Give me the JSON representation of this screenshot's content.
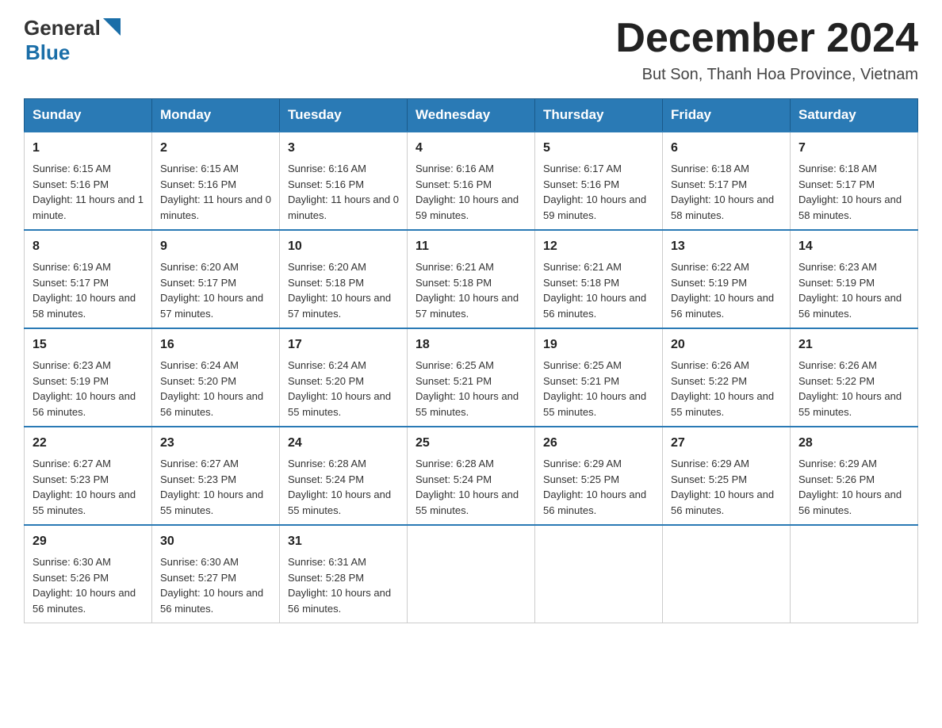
{
  "logo": {
    "general": "General",
    "blue": "Blue"
  },
  "header": {
    "title": "December 2024",
    "subtitle": "But Son, Thanh Hoa Province, Vietnam"
  },
  "weekdays": [
    "Sunday",
    "Monday",
    "Tuesday",
    "Wednesday",
    "Thursday",
    "Friday",
    "Saturday"
  ],
  "weeks": [
    [
      {
        "day": "1",
        "sunrise": "6:15 AM",
        "sunset": "5:16 PM",
        "daylight": "11 hours and 1 minute."
      },
      {
        "day": "2",
        "sunrise": "6:15 AM",
        "sunset": "5:16 PM",
        "daylight": "11 hours and 0 minutes."
      },
      {
        "day": "3",
        "sunrise": "6:16 AM",
        "sunset": "5:16 PM",
        "daylight": "11 hours and 0 minutes."
      },
      {
        "day": "4",
        "sunrise": "6:16 AM",
        "sunset": "5:16 PM",
        "daylight": "10 hours and 59 minutes."
      },
      {
        "day": "5",
        "sunrise": "6:17 AM",
        "sunset": "5:16 PM",
        "daylight": "10 hours and 59 minutes."
      },
      {
        "day": "6",
        "sunrise": "6:18 AM",
        "sunset": "5:17 PM",
        "daylight": "10 hours and 58 minutes."
      },
      {
        "day": "7",
        "sunrise": "6:18 AM",
        "sunset": "5:17 PM",
        "daylight": "10 hours and 58 minutes."
      }
    ],
    [
      {
        "day": "8",
        "sunrise": "6:19 AM",
        "sunset": "5:17 PM",
        "daylight": "10 hours and 58 minutes."
      },
      {
        "day": "9",
        "sunrise": "6:20 AM",
        "sunset": "5:17 PM",
        "daylight": "10 hours and 57 minutes."
      },
      {
        "day": "10",
        "sunrise": "6:20 AM",
        "sunset": "5:18 PM",
        "daylight": "10 hours and 57 minutes."
      },
      {
        "day": "11",
        "sunrise": "6:21 AM",
        "sunset": "5:18 PM",
        "daylight": "10 hours and 57 minutes."
      },
      {
        "day": "12",
        "sunrise": "6:21 AM",
        "sunset": "5:18 PM",
        "daylight": "10 hours and 56 minutes."
      },
      {
        "day": "13",
        "sunrise": "6:22 AM",
        "sunset": "5:19 PM",
        "daylight": "10 hours and 56 minutes."
      },
      {
        "day": "14",
        "sunrise": "6:23 AM",
        "sunset": "5:19 PM",
        "daylight": "10 hours and 56 minutes."
      }
    ],
    [
      {
        "day": "15",
        "sunrise": "6:23 AM",
        "sunset": "5:19 PM",
        "daylight": "10 hours and 56 minutes."
      },
      {
        "day": "16",
        "sunrise": "6:24 AM",
        "sunset": "5:20 PM",
        "daylight": "10 hours and 56 minutes."
      },
      {
        "day": "17",
        "sunrise": "6:24 AM",
        "sunset": "5:20 PM",
        "daylight": "10 hours and 55 minutes."
      },
      {
        "day": "18",
        "sunrise": "6:25 AM",
        "sunset": "5:21 PM",
        "daylight": "10 hours and 55 minutes."
      },
      {
        "day": "19",
        "sunrise": "6:25 AM",
        "sunset": "5:21 PM",
        "daylight": "10 hours and 55 minutes."
      },
      {
        "day": "20",
        "sunrise": "6:26 AM",
        "sunset": "5:22 PM",
        "daylight": "10 hours and 55 minutes."
      },
      {
        "day": "21",
        "sunrise": "6:26 AM",
        "sunset": "5:22 PM",
        "daylight": "10 hours and 55 minutes."
      }
    ],
    [
      {
        "day": "22",
        "sunrise": "6:27 AM",
        "sunset": "5:23 PM",
        "daylight": "10 hours and 55 minutes."
      },
      {
        "day": "23",
        "sunrise": "6:27 AM",
        "sunset": "5:23 PM",
        "daylight": "10 hours and 55 minutes."
      },
      {
        "day": "24",
        "sunrise": "6:28 AM",
        "sunset": "5:24 PM",
        "daylight": "10 hours and 55 minutes."
      },
      {
        "day": "25",
        "sunrise": "6:28 AM",
        "sunset": "5:24 PM",
        "daylight": "10 hours and 55 minutes."
      },
      {
        "day": "26",
        "sunrise": "6:29 AM",
        "sunset": "5:25 PM",
        "daylight": "10 hours and 56 minutes."
      },
      {
        "day": "27",
        "sunrise": "6:29 AM",
        "sunset": "5:25 PM",
        "daylight": "10 hours and 56 minutes."
      },
      {
        "day": "28",
        "sunrise": "6:29 AM",
        "sunset": "5:26 PM",
        "daylight": "10 hours and 56 minutes."
      }
    ],
    [
      {
        "day": "29",
        "sunrise": "6:30 AM",
        "sunset": "5:26 PM",
        "daylight": "10 hours and 56 minutes."
      },
      {
        "day": "30",
        "sunrise": "6:30 AM",
        "sunset": "5:27 PM",
        "daylight": "10 hours and 56 minutes."
      },
      {
        "day": "31",
        "sunrise": "6:31 AM",
        "sunset": "5:28 PM",
        "daylight": "10 hours and 56 minutes."
      },
      null,
      null,
      null,
      null
    ]
  ]
}
